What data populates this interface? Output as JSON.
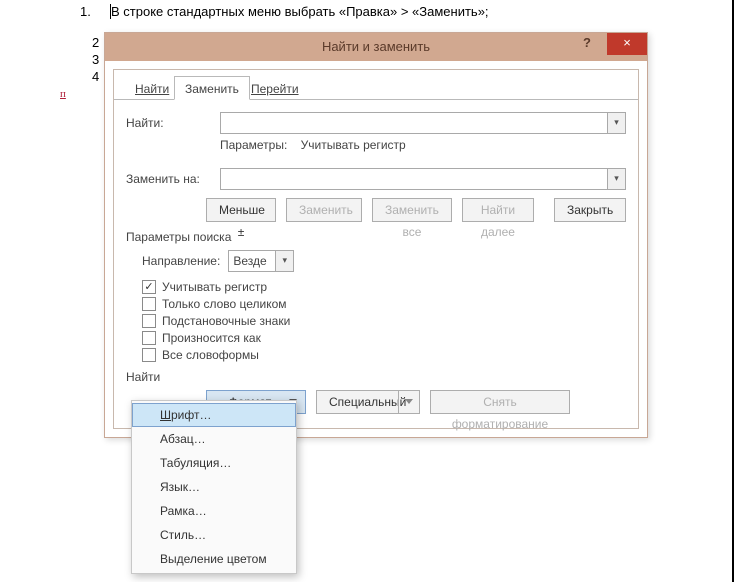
{
  "doc": {
    "list_num": "1.",
    "line1": "В строке стандартных меню выбрать «Правка» > «Заменить»;",
    "nums": [
      "2",
      "3",
      "4"
    ],
    "marker": "п"
  },
  "dialog": {
    "title": "Найти и заменить",
    "tabs": {
      "find": "Найти",
      "replace": "Заменить",
      "goto": "Перейти"
    },
    "labels": {
      "find": "Найти:",
      "options": "Параметры:",
      "options_value": "Учитывать регистр",
      "replace": "Заменить на:",
      "direction": "Направление:",
      "direction_value": "Везде",
      "search_params": "Параметры поиска",
      "find2": "Найти"
    },
    "buttons": {
      "less": "Меньше ±",
      "replace": "Заменить",
      "replace_all": "Заменить все",
      "find_next": "Найти далее",
      "close": "Закрыть",
      "format": "Формат",
      "special": "Специальный",
      "clear_fmt": "Снять форматирование"
    },
    "checks": {
      "case": "Учитывать регистр",
      "whole": "Только слово целиком",
      "wildcards": "Подстановочные знаки",
      "sounds": "Произносится как",
      "wordforms": "Все словоформы"
    }
  },
  "menu": {
    "font": "Шрифт…",
    "para": "Абзац…",
    "tabs": "Табуляция…",
    "lang": "Язык…",
    "frame": "Рамка…",
    "style": "Стиль…",
    "highlight": "Выделение цветом"
  }
}
